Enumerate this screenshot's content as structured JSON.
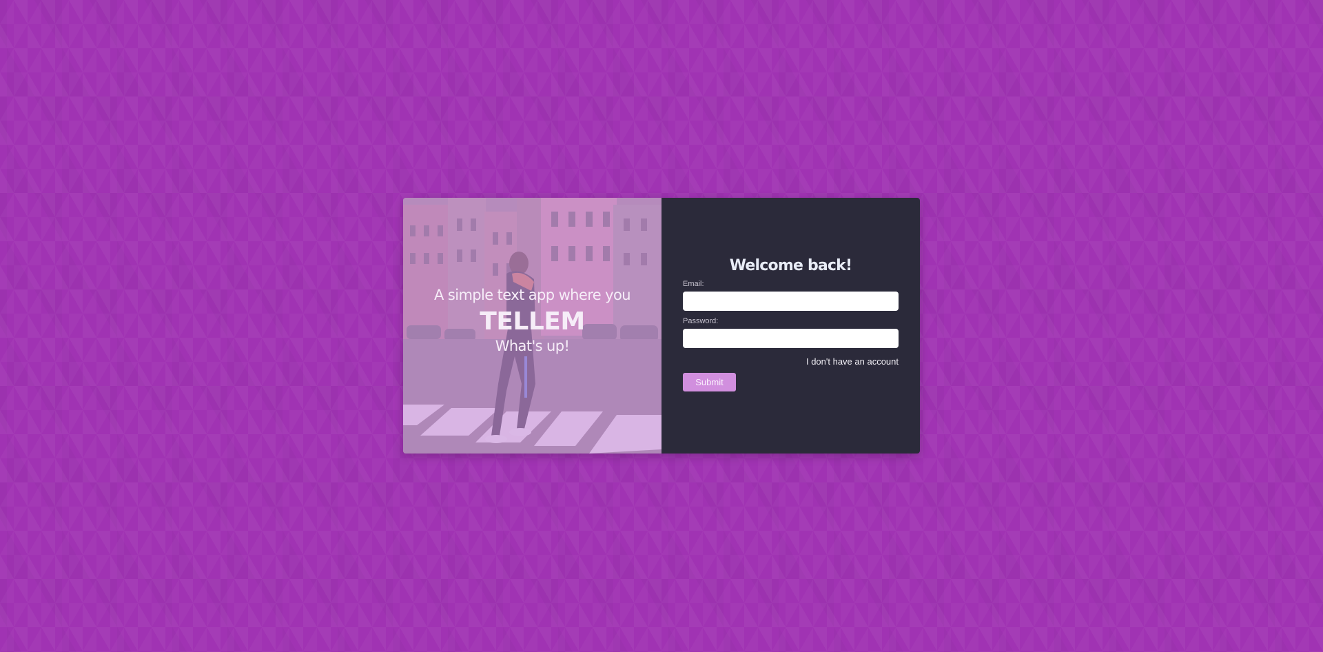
{
  "hero": {
    "tagline": "A simple text app where you",
    "brand": "TELLEM",
    "subline": "What's up!"
  },
  "form": {
    "title": "Welcome back!",
    "email_label": "Email:",
    "email_value": "",
    "password_label": "Password:",
    "password_value": "",
    "switch_link": "I don't have an account",
    "submit_label": "Submit"
  },
  "colors": {
    "page_background": "#a033b3",
    "form_panel": "#2b2a3a",
    "submit_button": "#d18fde",
    "hero_overlay": "#cd96e1"
  }
}
